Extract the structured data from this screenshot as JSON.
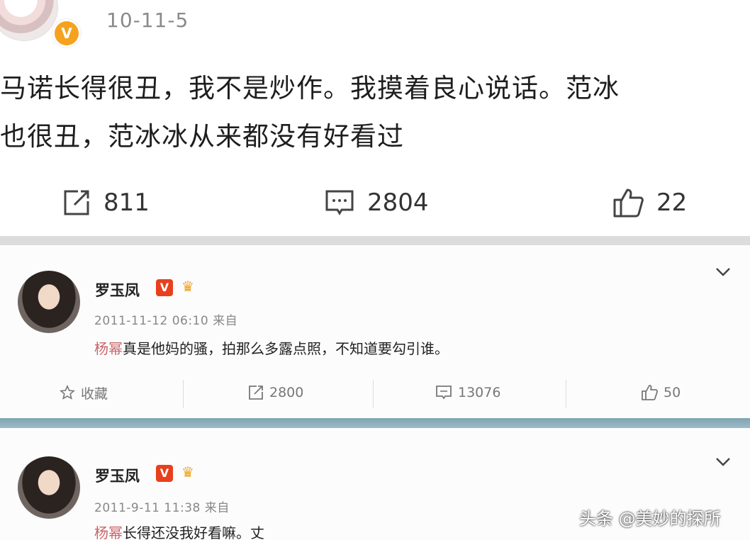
{
  "post1": {
    "date": "10-11-5",
    "verified_icon": "v-badge",
    "text_line1": "马诺长得很丑，我不是炒作。我摸着良心说话。范冰",
    "text_line2": "也很丑，范冰冰从来都没有好看过",
    "actions": {
      "repost_icon": "repost-icon",
      "repost_count": "811",
      "comment_icon": "comment-icon",
      "comment_count": "2804",
      "like_icon": "thumbs-up-icon",
      "like_count": "22"
    }
  },
  "post2": {
    "name": "罗玉凤",
    "verified_badge": "V",
    "time_source": "2011-11-12 06:10 来自",
    "mention": "杨幂",
    "text": "真是他妈的骚，拍那么多露点照，不知道要勾引谁。",
    "actions": {
      "favorite_label": "收藏",
      "repost_count": "2800",
      "comment_count": "13076",
      "like_count": "50"
    }
  },
  "post3": {
    "name": "罗玉凤",
    "verified_badge": "V",
    "time_source": "2011-9-11 11:38 来自",
    "mention": "杨幂",
    "text": "长得还没我好看嘛。丈"
  },
  "watermark": "头条 @美妙的探所",
  "colors": {
    "mention": "#c9646a",
    "verified_orange": "#f6a21e",
    "verified_red": "#e8401c",
    "separator_blue": "#8aaebc"
  }
}
